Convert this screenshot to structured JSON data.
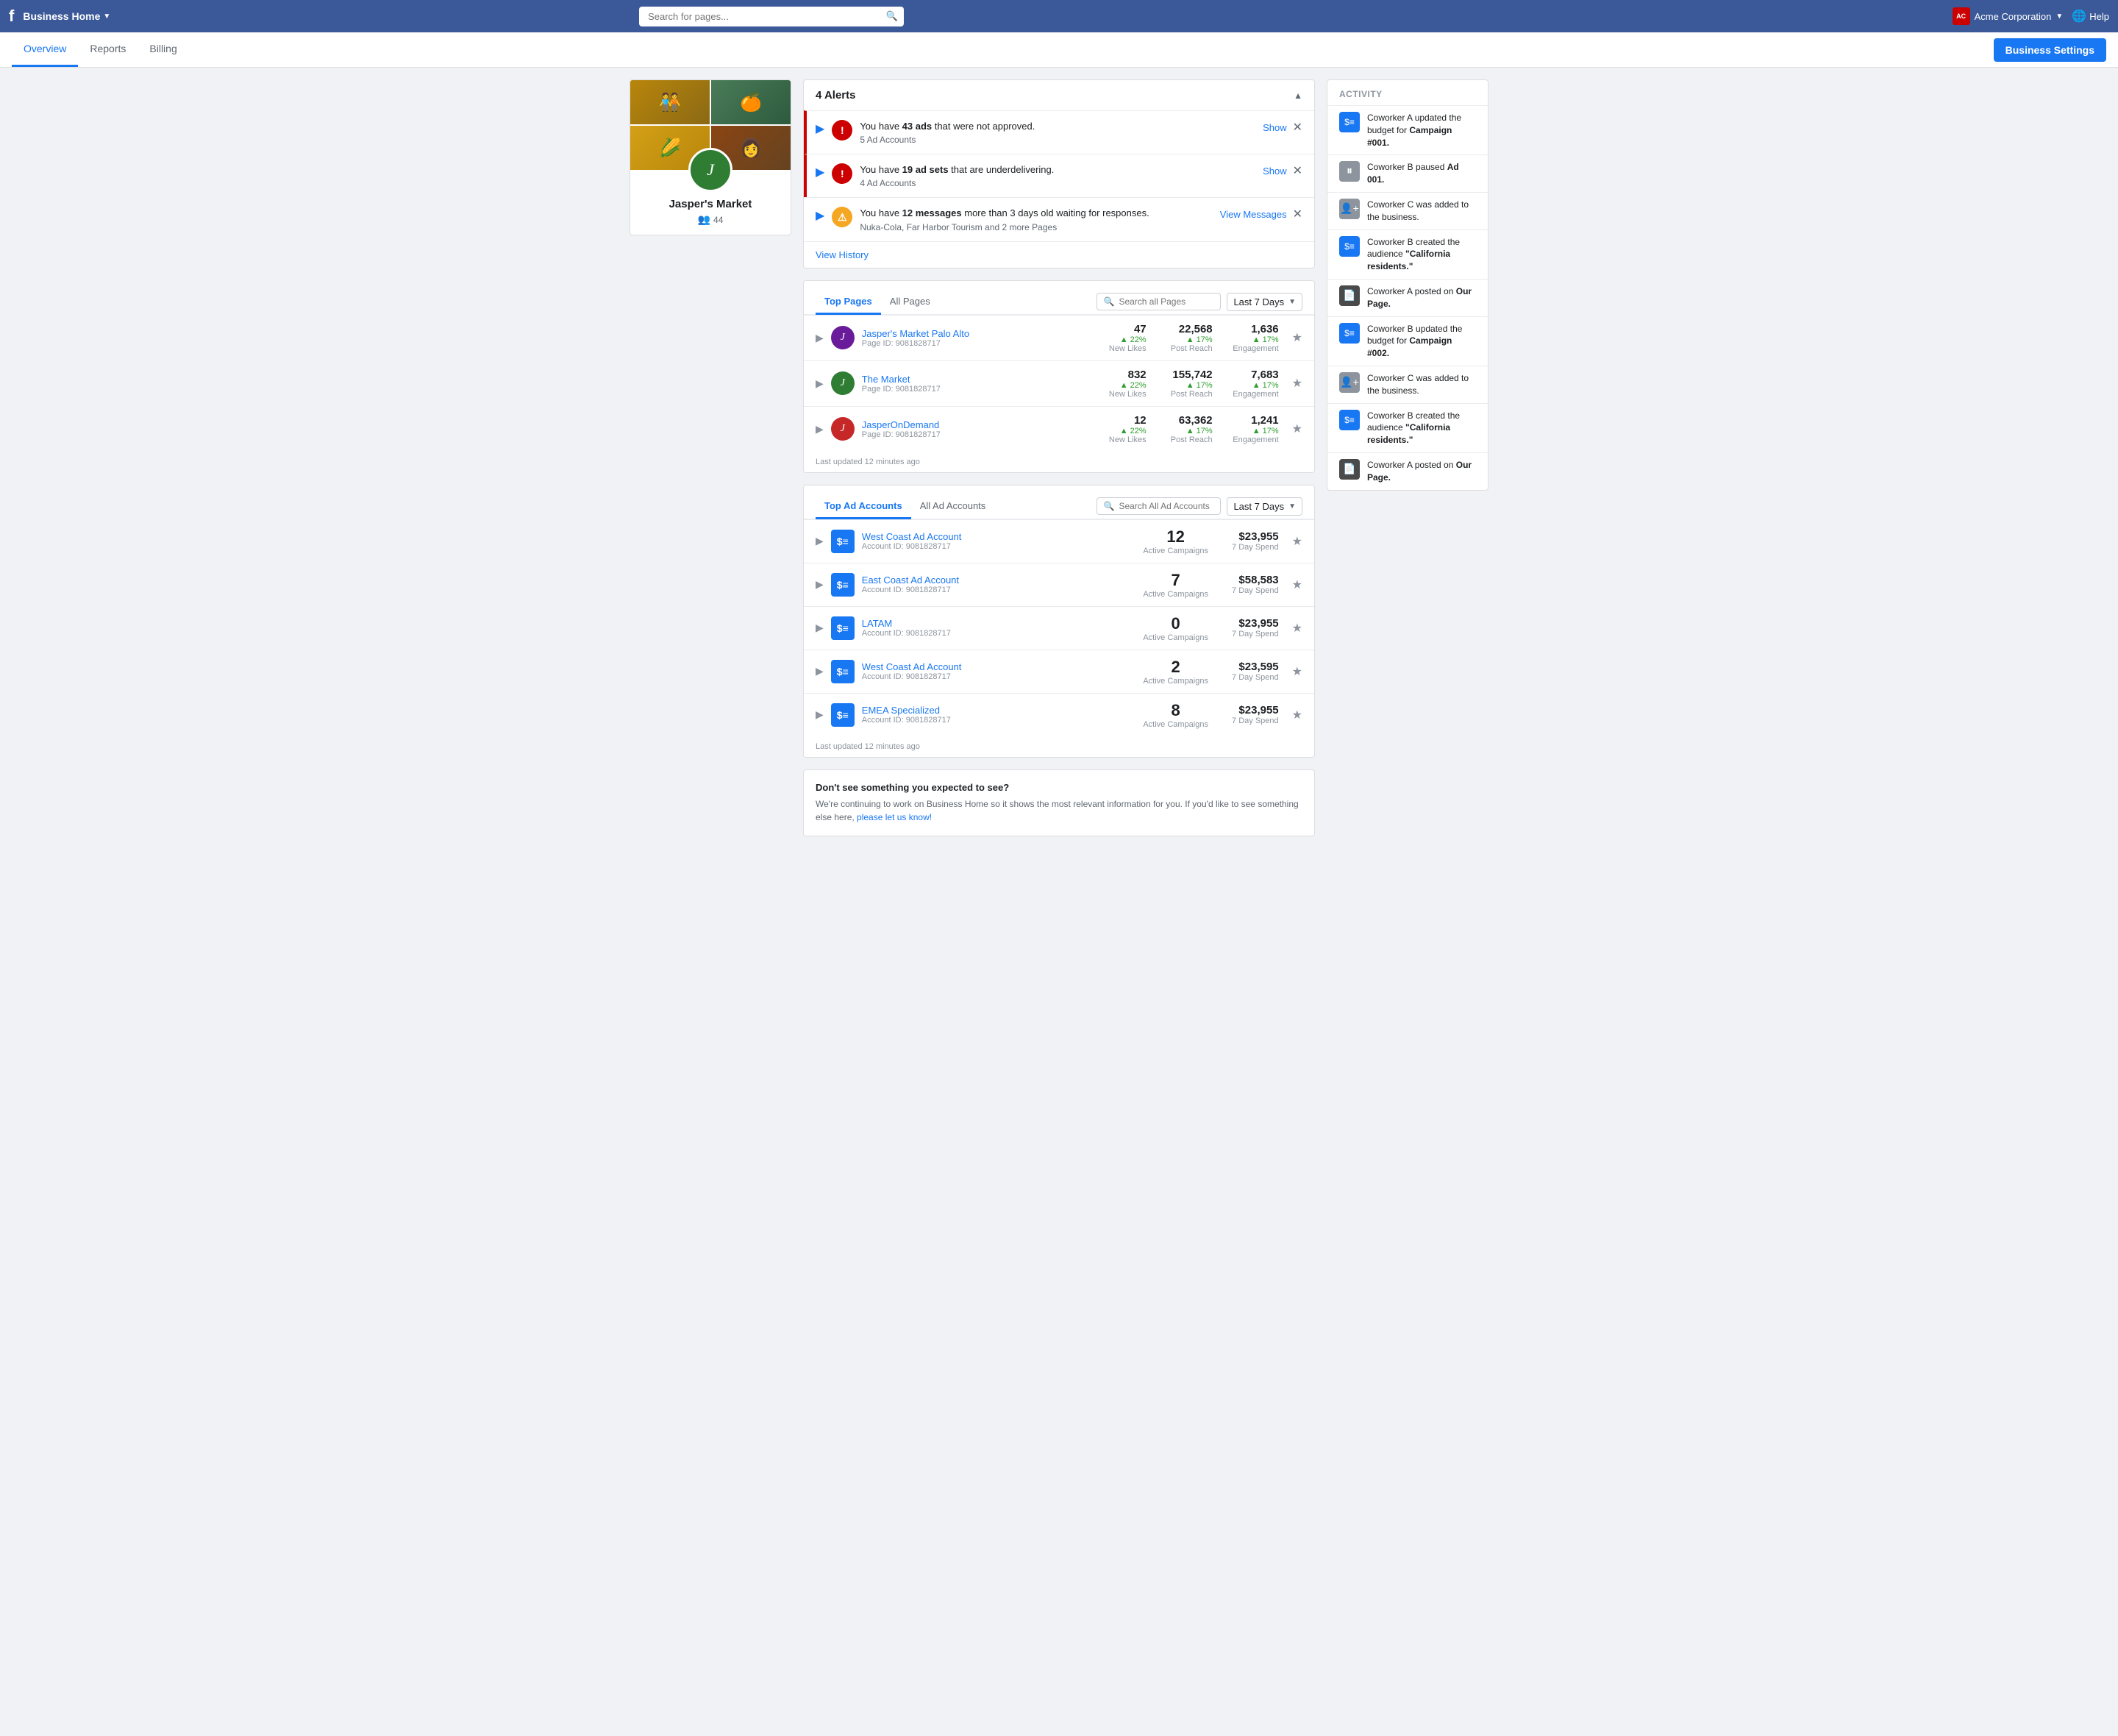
{
  "topbar": {
    "logo": "f",
    "brand": "Business Home",
    "search_placeholder": "Search for pages...",
    "account_name": "Acme Corporation",
    "help_label": "Help"
  },
  "nav": {
    "tabs": [
      {
        "label": "Overview",
        "active": true
      },
      {
        "label": "Reports",
        "active": false
      },
      {
        "label": "Billing",
        "active": false
      }
    ],
    "business_settings": "Business Settings"
  },
  "profile": {
    "name": "Jasper's Market",
    "followers": "44",
    "logo_letter": "J"
  },
  "alerts": {
    "title": "4 Alerts",
    "items": [
      {
        "type": "error",
        "text_prefix": "You have ",
        "highlight": "43 ads",
        "text_suffix": " that were not approved.",
        "subtext": "5 Ad Accounts",
        "action": "Show"
      },
      {
        "type": "error",
        "text_prefix": "You have ",
        "highlight": "19 ad sets",
        "text_suffix": " that are underdelivering.",
        "subtext": "4 Ad Accounts",
        "action": "Show"
      },
      {
        "type": "warning",
        "text_prefix": "You have ",
        "highlight": "12 messages",
        "text_suffix": " more than 3 days old waiting for responses.",
        "subtext": "Nuka-Cola, Far Harbor Tourism and 2 more Pages",
        "action": "View Messages"
      }
    ],
    "view_history": "View History"
  },
  "top_pages": {
    "tab1": "Top Pages",
    "tab2": "All Pages",
    "search_placeholder": "Search all Pages",
    "days_label": "Last 7 Days",
    "rows": [
      {
        "name": "Jasper's Market Palo Alto",
        "id": "Page ID: 9081828717",
        "icon_color": "purple",
        "stat1_num": "47",
        "stat1_change": "▲ 22%",
        "stat1_label": "New Likes",
        "stat2_num": "22,568",
        "stat2_change": "▲ 17%",
        "stat2_label": "Post Reach",
        "stat3_num": "1,636",
        "stat3_change": "▲ 17%",
        "stat3_label": "Engagement"
      },
      {
        "name": "The Market",
        "id": "Page ID: 9081828717",
        "icon_color": "green",
        "stat1_num": "832",
        "stat1_change": "▲ 22%",
        "stat1_label": "New Likes",
        "stat2_num": "155,742",
        "stat2_change": "▲ 17%",
        "stat2_label": "Post Reach",
        "stat3_num": "7,683",
        "stat3_change": "▲ 17%",
        "stat3_label": "Engagement"
      },
      {
        "name": "JasperOnDemand",
        "id": "Page ID: 9081828717",
        "icon_color": "red",
        "stat1_num": "12",
        "stat1_change": "▲ 22%",
        "stat1_label": "New Likes",
        "stat2_num": "63,362",
        "stat2_change": "▲ 17%",
        "stat2_label": "Post Reach",
        "stat3_num": "1,241",
        "stat3_change": "▲ 17%",
        "stat3_label": "Engagement"
      }
    ],
    "last_updated": "Last updated 12 minutes ago"
  },
  "top_ad_accounts": {
    "tab1": "Top Ad Accounts",
    "tab2": "All Ad Accounts",
    "search_placeholder": "Search All Ad Accounts",
    "days_label": "Last 7 Days",
    "rows": [
      {
        "name": "West Coast Ad Account",
        "id": "Account ID: 9081828717",
        "campaigns": "12",
        "campaigns_label": "Active Campaigns",
        "spend": "$23,955",
        "spend_label": "7 Day Spend"
      },
      {
        "name": "East Coast Ad Account",
        "id": "Account ID: 9081828717",
        "campaigns": "7",
        "campaigns_label": "Active Campaigns",
        "spend": "$58,583",
        "spend_label": "7 Day Spend"
      },
      {
        "name": "LATAM",
        "id": "Account ID: 9081828717",
        "campaigns": "0",
        "campaigns_label": "Active Campaigns",
        "spend": "$23,955",
        "spend_label": "7 Day Spend"
      },
      {
        "name": "West Coast Ad Account",
        "id": "Account ID: 9081828717",
        "campaigns": "2",
        "campaigns_label": "Active Campaigns",
        "spend": "$23,595",
        "spend_label": "7 Day Spend"
      },
      {
        "name": "EMEA Specialized",
        "id": "Account ID: 9081828717",
        "campaigns": "8",
        "campaigns_label": "Active Campaigns",
        "spend": "$23,955",
        "spend_label": "7 Day Spend"
      }
    ],
    "last_updated": "Last updated 12 minutes ago"
  },
  "activity": {
    "title": "ACTIVITY",
    "items": [
      {
        "type": "dollar",
        "icon_color": "green",
        "text": "Coworker A updated the budget for ",
        "highlight": "Campaign #001."
      },
      {
        "type": "pause",
        "icon_color": "grey",
        "text": "Coworker B paused ",
        "highlight": "Ad 001."
      },
      {
        "type": "person-add",
        "icon_color": "grey",
        "text": "Coworker C was added to the business.",
        "highlight": ""
      },
      {
        "type": "dollar",
        "icon_color": "green",
        "text": "Coworker B created the audience ",
        "highlight": "\"California residents.\""
      },
      {
        "type": "doc",
        "icon_color": "dark",
        "text": "Coworker A posted on ",
        "highlight": "Our Page."
      },
      {
        "type": "dollar",
        "icon_color": "green",
        "text": "Coworker B updated the budget for ",
        "highlight": "Campaign #002."
      },
      {
        "type": "person-add",
        "icon_color": "grey",
        "text": "Coworker C was added to the business.",
        "highlight": ""
      },
      {
        "type": "dollar",
        "icon_color": "green",
        "text": "Coworker B created the audience ",
        "highlight": "\"California residents.\""
      },
      {
        "type": "doc",
        "icon_color": "dark",
        "text": "Coworker A posted on ",
        "highlight": "Our Page."
      }
    ]
  },
  "footer": {
    "title": "Don't see something you expected to see?",
    "text": "We're continuing to work on Business Home so it shows the most relevant information for you. If you'd like to see something else here, ",
    "link_text": "please let us know!",
    "link_href": "#"
  }
}
